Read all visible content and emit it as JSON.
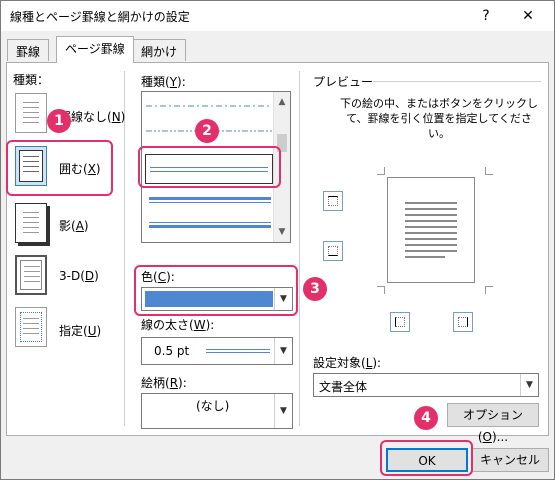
{
  "window": {
    "title": "線種とページ罫線と網かけの設定",
    "help": "?",
    "close": "✕"
  },
  "tabs": [
    {
      "label": "罫線"
    },
    {
      "label": "ページ罫線"
    },
    {
      "label": "網かけ"
    }
  ],
  "settype": {
    "heading": "種類：",
    "items": [
      {
        "label": "罫線なし(",
        "key": "N",
        "suffix": ")"
      },
      {
        "label": "囲む(",
        "key": "X",
        "suffix": ")"
      },
      {
        "label": "影(",
        "key": "A",
        "suffix": ")"
      },
      {
        "label": "3-D(",
        "key": "D",
        "suffix": ")"
      },
      {
        "label": "指定(",
        "key": "U",
        "suffix": ")"
      }
    ]
  },
  "style": {
    "label": "種類(",
    "key": "Y",
    "suffix": "):"
  },
  "color": {
    "label": "色(",
    "key": "C",
    "suffix": "):",
    "value": "#4f87d2"
  },
  "width": {
    "label": "線の太さ(",
    "key": "W",
    "suffix": "):",
    "value": "0.5 pt"
  },
  "art": {
    "label": "絵柄(",
    "key": "R",
    "suffix": "):",
    "value": "(なし)"
  },
  "preview": {
    "label": "プレビュー",
    "instruction": "下の絵の中、またはボタンをクリックして、罫線を引く位置を指定してください。"
  },
  "apply_to": {
    "label": "設定対象(",
    "key": "L",
    "suffix": "):",
    "value": "文書全体"
  },
  "buttons": {
    "options": "オプション(",
    "options_key": "O",
    "options_suffix": ")...",
    "ok": "OK",
    "cancel": "キャンセル"
  },
  "callouts": [
    "1",
    "2",
    "3",
    "4"
  ],
  "colors": {
    "accent_red": "#e3306a",
    "selection_blue": "#3c7fc4"
  }
}
